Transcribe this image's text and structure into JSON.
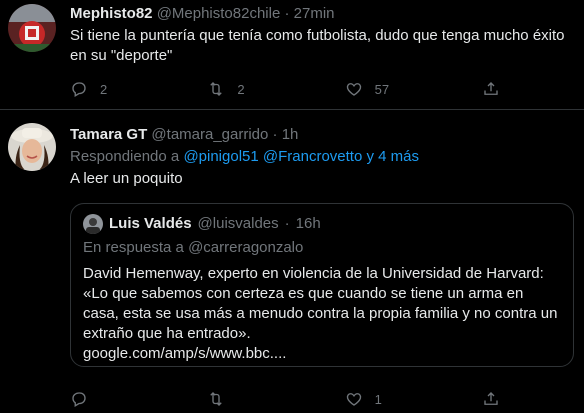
{
  "tweets": [
    {
      "name": "Mephisto82",
      "handle": "@Mephisto82chile",
      "sep": "·",
      "time": "27min",
      "text": "Si tiene la puntería que tenía como futbolista, dudo que tenga mucho éxito en su \"deporte\"",
      "reply_count": "2",
      "retweet_count": "2",
      "like_count": "57"
    },
    {
      "name": "Tamara GT",
      "handle": "@tamara_garrido",
      "sep": "·",
      "time": "1h",
      "reply_prefix": "Respondiendo a ",
      "mention1": "@pinigol51",
      "mention2": "@Francrovetto y 4 más",
      "text": "A leer un poquito",
      "reply_count": "",
      "retweet_count": "",
      "like_count": "1"
    }
  ],
  "quote": {
    "name": "Luis Valdés",
    "handle": "@luisvaldes",
    "sep": "·",
    "time": "16h",
    "reply_prefix": "En respuesta a ",
    "reply_handle": "@carreragonzalo",
    "text": "David Hemenway, experto en violencia de la Universidad de Harvard:\n«Lo que sabemos con certeza es que cuando se tiene un arma en casa, esta se usa más a menudo contra la propia familia y no contra un extraño que ha entrado».\ngoogle.com/amp/s/www.bbc...."
  },
  "icons": {
    "reply": "reply-icon",
    "retweet": "retweet-icon",
    "like": "heart-icon",
    "share": "share-icon"
  },
  "colors": {
    "background": "#000000",
    "text": "#e7e9ea",
    "muted": "#71767b",
    "link": "#1d9bf0",
    "border": "#2f3336"
  }
}
